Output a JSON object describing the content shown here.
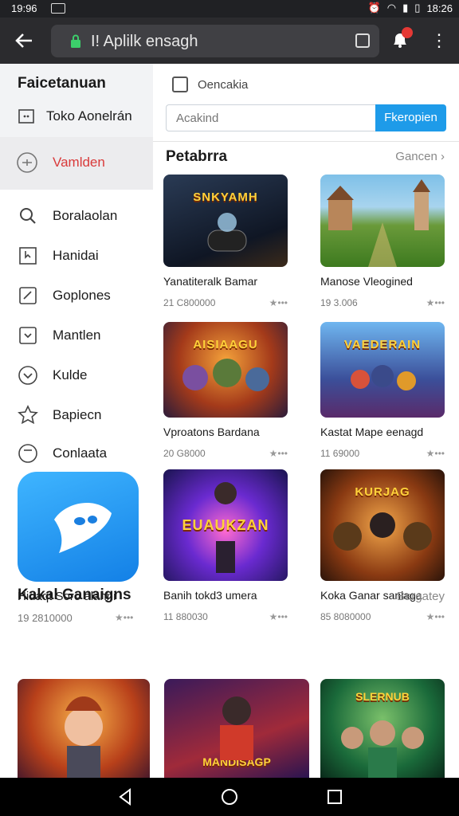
{
  "status_bar": {
    "time_left": "19:96",
    "time_right": "18:26"
  },
  "browser": {
    "url": "I! Aplilk ensagh",
    "tab_icon": "tab-switcher-icon",
    "menu_icon": "overflow-menu-icon"
  },
  "sidebar": {
    "title": "Faicetanuan",
    "subtitle": "Toko Aonelrán",
    "active_item": "Vamlden",
    "items": [
      {
        "label": "Boralaolan",
        "icon": "search-icon"
      },
      {
        "label": "Hanidai",
        "icon": "bookmark-icon"
      },
      {
        "label": "Goplones",
        "icon": "edit-icon"
      },
      {
        "label": "Mantlen",
        "icon": "download-icon"
      },
      {
        "label": "Kulde",
        "icon": "chevron-circle-icon"
      },
      {
        "label": "Bapiecn",
        "icon": "star-icon"
      },
      {
        "label": "Conlaata",
        "icon": "smile-icon"
      }
    ],
    "featured_app": {
      "title": "Hidaqt Soro alahni",
      "meta": "19 2810000"
    }
  },
  "main": {
    "header_label": "Oencakia",
    "search": {
      "placeholder": "Acakind",
      "button": "Fkeropien"
    },
    "section": {
      "title": "Petabrra",
      "more": "Gancen"
    },
    "cards": [
      {
        "title": "Yanatiteralk Bamar",
        "meta": "21 C800000",
        "tag": "SNKYAMH"
      },
      {
        "title": "Manose Vleogined",
        "meta": "19 3.006",
        "tag": ""
      },
      {
        "title": "Vproatons Bardana",
        "meta": "20 G8000",
        "tag": "AISIAAGU"
      },
      {
        "title": "Kastat Mape eenagd",
        "meta": "11 69000",
        "tag": "VAEDERAIN"
      },
      {
        "title": "Banih tokd3 umera",
        "meta": "11 880030",
        "tag": "EUAUKZAN"
      },
      {
        "title": "Koka Ganar sanlaga",
        "meta": "85 8080000",
        "tag": "KURJAG"
      }
    ],
    "bottom_section": {
      "title": "Kakal Ganaigns",
      "more": "Bargatey"
    },
    "bottom_cards": [
      {
        "tag": ""
      },
      {
        "tag": "MANDISAGP"
      },
      {
        "tag": "SLERNUB"
      }
    ]
  }
}
